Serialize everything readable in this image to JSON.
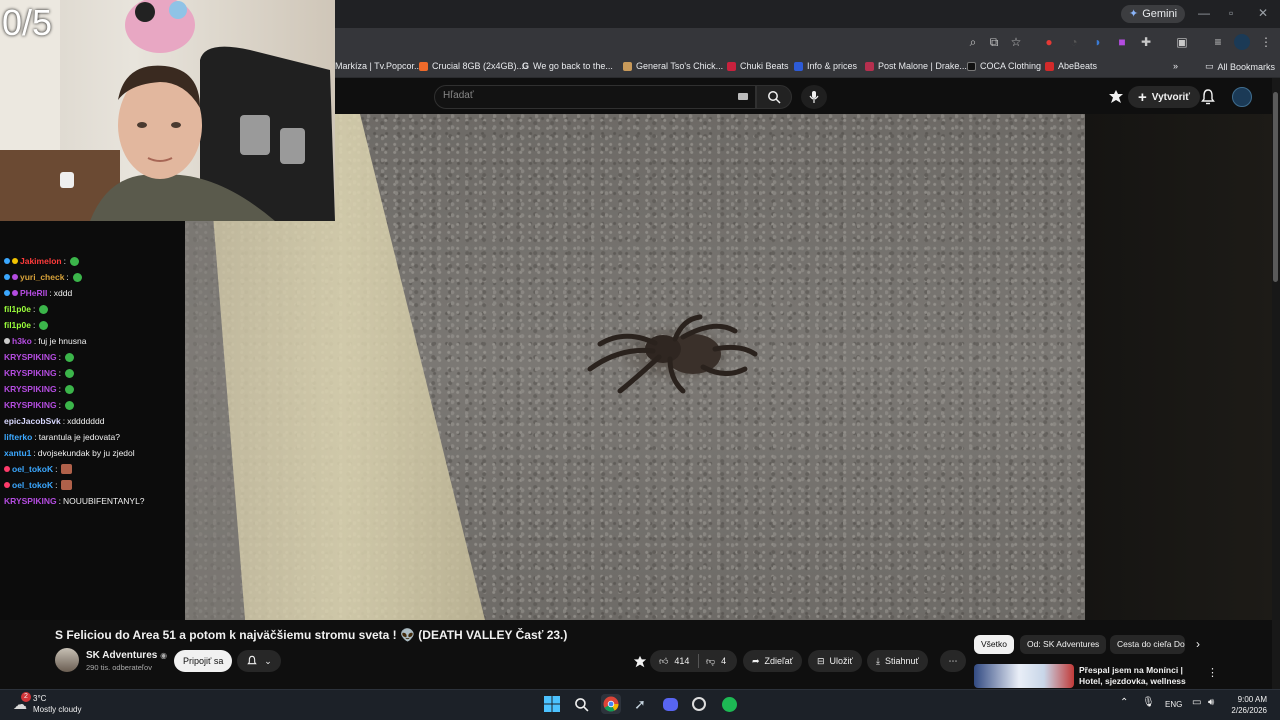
{
  "browser": {
    "gemini_label": "Gemini",
    "bookmarks": [
      {
        "label": "Markíza | Tv.Popcor...",
        "color": "#e03c31"
      },
      {
        "label": "Crucial 8GB (2x4GB)...",
        "color": "#ef6a2a"
      },
      {
        "label": "We go back to the...",
        "color": "#4285f4",
        "glyph": "G"
      },
      {
        "label": "General Tso's Chick...",
        "color": "#c89a5a"
      },
      {
        "label": "Chuki Beats",
        "color": "#c8213d"
      },
      {
        "label": "Info & prices",
        "color": "#2d5bd7",
        "glyph": "B."
      },
      {
        "label": "Post Malone | Drake...",
        "color": "#b52f4e"
      },
      {
        "label": "COCA Clothing",
        "color": "#222222"
      },
      {
        "label": "AbeBeats",
        "color": "#d22a2a"
      }
    ],
    "all_bookmarks": "All Bookmarks"
  },
  "youtube": {
    "search_placeholder": "Hľadať",
    "create_label": "Vytvoriť"
  },
  "stream": {
    "counter": "0/5"
  },
  "chat": [
    {
      "user": "Jakimelon",
      "text": "",
      "color": "#ff3b3b",
      "emote": "green"
    },
    {
      "user": "yuri_check",
      "text": "",
      "color": "#d8a23a",
      "emote": "green"
    },
    {
      "user": "PHeRII",
      "text": "xddd",
      "color": "#b44ce0",
      "emote": ""
    },
    {
      "user": "fil1p0e",
      "text": "",
      "color": "#9bff3b",
      "emote": "green"
    },
    {
      "user": "fil1p0e",
      "text": "",
      "color": "#9bff3b",
      "emote": "green"
    },
    {
      "user": "h3ko",
      "text": "fuj je hnusna",
      "color": "#b44ce0",
      "emote": ""
    },
    {
      "user": "KRYSPIKING",
      "text": "",
      "color": "#b44ce0",
      "emote": "green"
    },
    {
      "user": "KRYSPIKING",
      "text": "",
      "color": "#b44ce0",
      "emote": "green"
    },
    {
      "user": "KRYSPIKING",
      "text": "",
      "color": "#b44ce0",
      "emote": "green"
    },
    {
      "user": "KRYSPIKING",
      "text": "",
      "color": "#b44ce0",
      "emote": "green"
    },
    {
      "user": "epicJacobSvk",
      "text": "xddddddd",
      "color": "#d8d8ff",
      "emote": ""
    },
    {
      "user": "lifterko",
      "text": "tarantula je jedovata?",
      "color": "#3ba8ff",
      "emote": ""
    },
    {
      "user": "xantu1",
      "text": "dvojsekundak by ju zjedol",
      "color": "#3ba8ff",
      "emote": ""
    },
    {
      "user": "oel_tokoK",
      "text": "",
      "color": "#3ba8ff",
      "emote": "red"
    },
    {
      "user": "oel_tokoK",
      "text": "",
      "color": "#3ba8ff",
      "emote": "red"
    },
    {
      "user": "KRYSPIKING",
      "text": "NOUUBIFENTANYL?",
      "color": "#b44ce0",
      "emote": ""
    }
  ],
  "video": {
    "title": "S Feliciou do Area 51 a potom k najväčšiemu stromu sveta ! 👽 (DEATH VALLEY Časť 23.)",
    "channel": "SK Adventures",
    "subscribers": "290 tis. odberateľov",
    "join_label": "Pripojiť sa",
    "likes": "414",
    "dislikes": "4",
    "share_label": "Zdieľať",
    "save_label": "Uložiť",
    "download_label": "Stiahnuť"
  },
  "chips": [
    "Všetko",
    "Od: SK Adventures",
    "Cesta do cieľa Do"
  ],
  "recommendation": {
    "title": "Přespal jsem na Monínci | Hotel, sjezdovka, wellness"
  },
  "taskbar": {
    "temp": "3°C",
    "weather": "Mostly cloudy",
    "lang": "ENG",
    "time": "9:00 AM",
    "date": "2/26/2026",
    "notif_count": "2"
  }
}
